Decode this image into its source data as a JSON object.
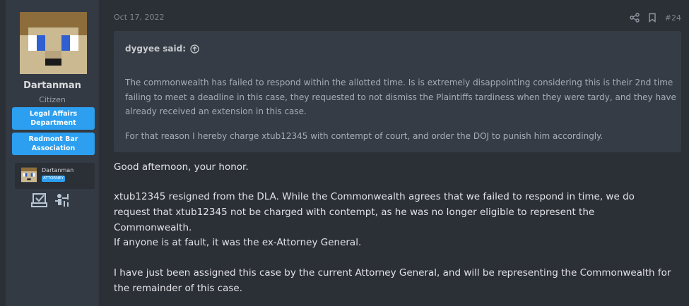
{
  "user": {
    "name": "Dartanman",
    "title": "Citizen",
    "badges": [
      "Legal Affairs Department",
      "Redmont Bar Association"
    ],
    "mini_card": {
      "name": "Dartanman",
      "tag": "ATTORNEY"
    },
    "trophy_icons": [
      "ballot-box-icon",
      "justice-figure-icon"
    ]
  },
  "post": {
    "date": "Oct 17, 2022",
    "number": "#24",
    "action_icons": [
      "share-icon",
      "bookmark-icon"
    ],
    "quote": {
      "author_label": "dygyee said:",
      "p1": "The commonwealth has failed to respond within the allotted time. Is is extremely disappointing considering this is their 2nd time failing to meet a deadline in this case, they requested to not dismiss the Plaintiffs tardiness when they were tardy, and they have already received an extension in this case.",
      "p2": "For that reason I hereby charge xtub12345 with contempt of court, and order the DOJ to punish him accordingly."
    },
    "body": [
      "Good afternoon, your honor.",
      "xtub12345 resigned from the DLA. While the Commonwealth agrees that we failed to respond in time, we do request that xtub12345 not be charged with contempt, as he was no longer eligible to represent the Commonwealth.",
      "If anyone is at fault, it was the ex-Attorney General.",
      "I have just been assigned this case by the current Attorney General, and will be representing the Commonwealth for the remainder of this case."
    ]
  },
  "colors": {
    "background": "#2b2f36",
    "sidebar": "#343a43",
    "quote_bg": "#363c45",
    "accent": "#2c9ff0"
  }
}
